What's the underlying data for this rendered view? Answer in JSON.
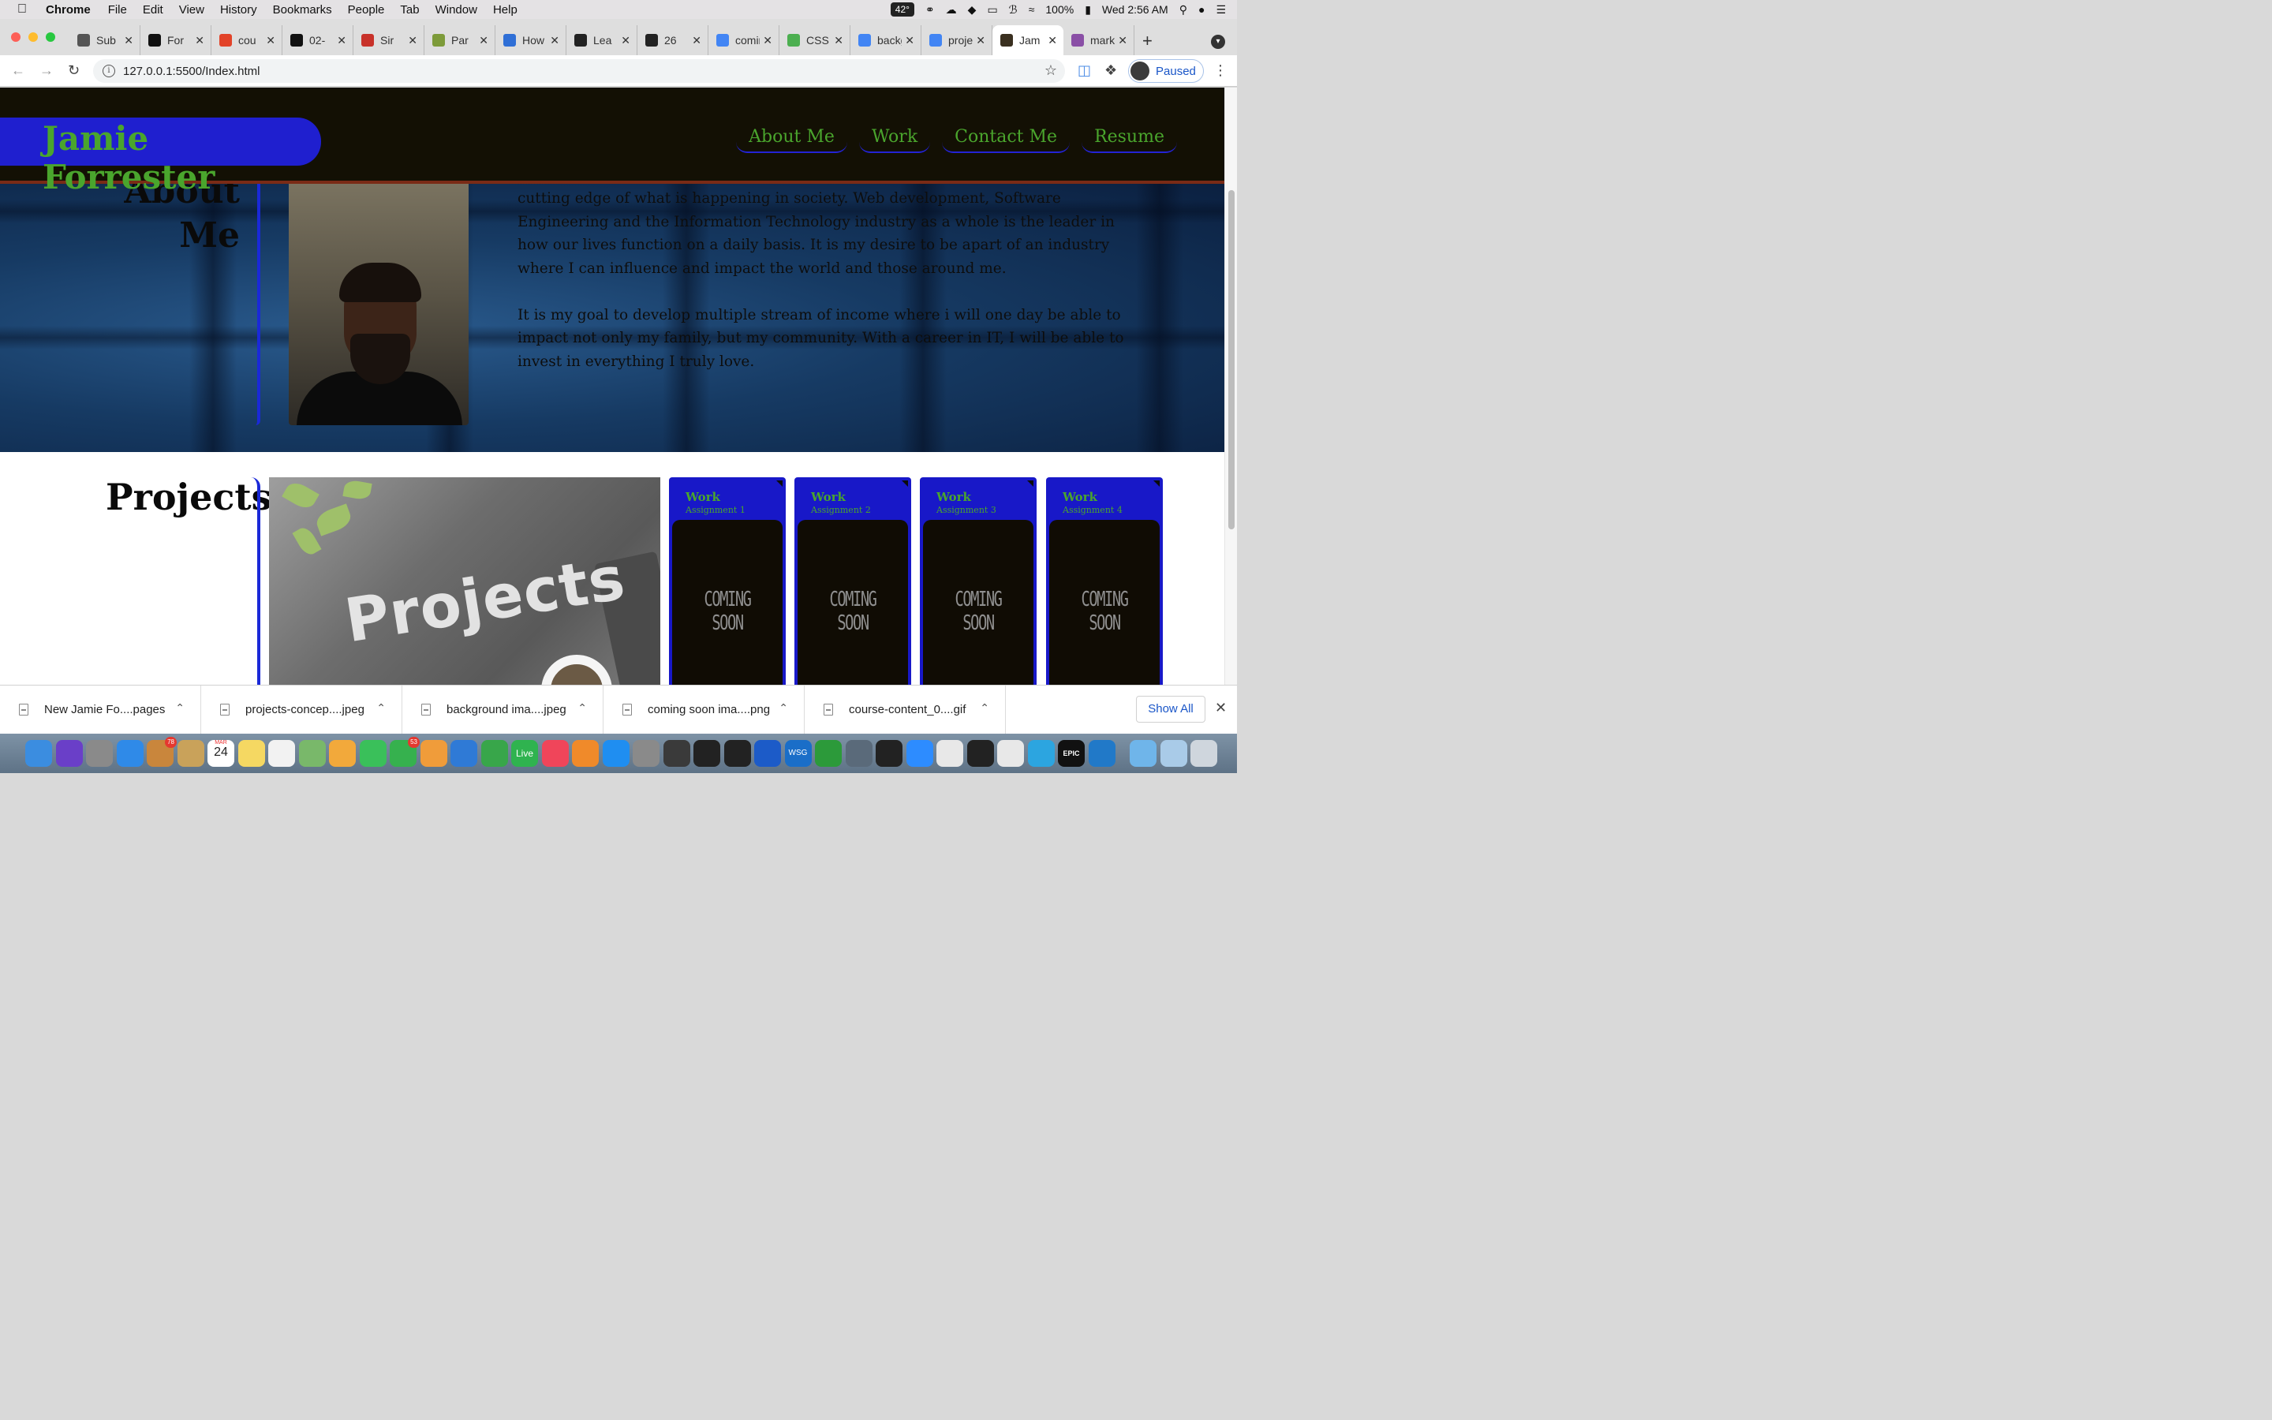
{
  "menubar": {
    "app_name": "Chrome",
    "items": [
      "File",
      "Edit",
      "View",
      "History",
      "Bookmarks",
      "People",
      "Tab",
      "Window",
      "Help"
    ],
    "weather": "42°",
    "battery": "100%",
    "datetime": "Wed 2:56 AM"
  },
  "tabs": [
    {
      "title": "Sub",
      "icon": "globe-icon",
      "color": "#555555"
    },
    {
      "title": "For",
      "icon": "github-icon",
      "color": "#111111"
    },
    {
      "title": "cou",
      "icon": "gitlab-icon",
      "color": "#e24329"
    },
    {
      "title": "02-",
      "icon": "github-icon",
      "color": "#111111"
    },
    {
      "title": "Sir",
      "icon": "colorful-icon",
      "color": "#c8322a"
    },
    {
      "title": "Par",
      "icon": "m-icon",
      "color": "#7d9b3a"
    },
    {
      "title": "How",
      "icon": "circle-icon",
      "color": "#2f6fd6"
    },
    {
      "title": "Lea",
      "icon": "shield-icon",
      "color": "#222222"
    },
    {
      "title": "26",
      "icon": "bars-icon",
      "color": "#222222"
    },
    {
      "title": "coming",
      "icon": "google-icon",
      "color": "#4285f4"
    },
    {
      "title": "CSS Fo",
      "icon": "w3-icon",
      "color": "#4caf50"
    },
    {
      "title": "backgr",
      "icon": "google-icon",
      "color": "#4285f4"
    },
    {
      "title": "project",
      "icon": "google-icon",
      "color": "#4285f4"
    },
    {
      "title": "Jam",
      "icon": "photo-icon",
      "color": "#3a3020",
      "active": true
    },
    {
      "title": "markdo",
      "icon": "feather-icon",
      "color": "#8a4fa6"
    }
  ],
  "toolbar": {
    "url": "127.0.0.1:5500/Index.html",
    "profile_label": "Paused"
  },
  "site": {
    "brand": "Jamie Forrester",
    "nav": [
      "About Me",
      "Work",
      "Contact Me",
      "Resume"
    ],
    "about": {
      "title": "About Me",
      "paragraph1": "cutting edge of what is happening in society. Web development, Software Engineering and the Information Technology industry as a whole is the leader in how our lives function on a daily basis. It is my desire to be apart of an industry where I can influence and impact the world and those around me.",
      "paragraph2": "It is my goal to develop multiple stream of income where i will one day be able to impact not only my family, but my community. With a career in IT, I will be able to invest in everything I truly love."
    },
    "projects": {
      "title": "Projects",
      "hero_word": "Projects",
      "cards": [
        {
          "title": "Work",
          "subtitle": "Assignment 1",
          "image_text": "COMING SOON"
        },
        {
          "title": "Work",
          "subtitle": "Assignment 2",
          "image_text": "COMING SOON"
        },
        {
          "title": "Work",
          "subtitle": "Assignment 3",
          "image_text": "COMING SOON"
        },
        {
          "title": "Work",
          "subtitle": "Assignment 4",
          "image_text": "COMING SOON"
        }
      ]
    }
  },
  "downloads": {
    "items": [
      "New Jamie Fo....pages",
      "projects-concep....jpeg",
      "background ima....jpeg",
      "coming soon ima....png",
      "course-content_0....gif"
    ],
    "show_all_label": "Show All"
  },
  "dock": {
    "calendar_month": "MAR",
    "calendar_day": "24",
    "badge_launchpad": "78",
    "badge_facetime": "53",
    "live_label": "Live",
    "wsg_label": "WSG",
    "epic_label": "EPIC"
  },
  "colors": {
    "brand_blue": "#1f1fcf",
    "brand_green": "#4aa52d",
    "header_bg": "#131004",
    "card_blue": "#1818c8"
  }
}
